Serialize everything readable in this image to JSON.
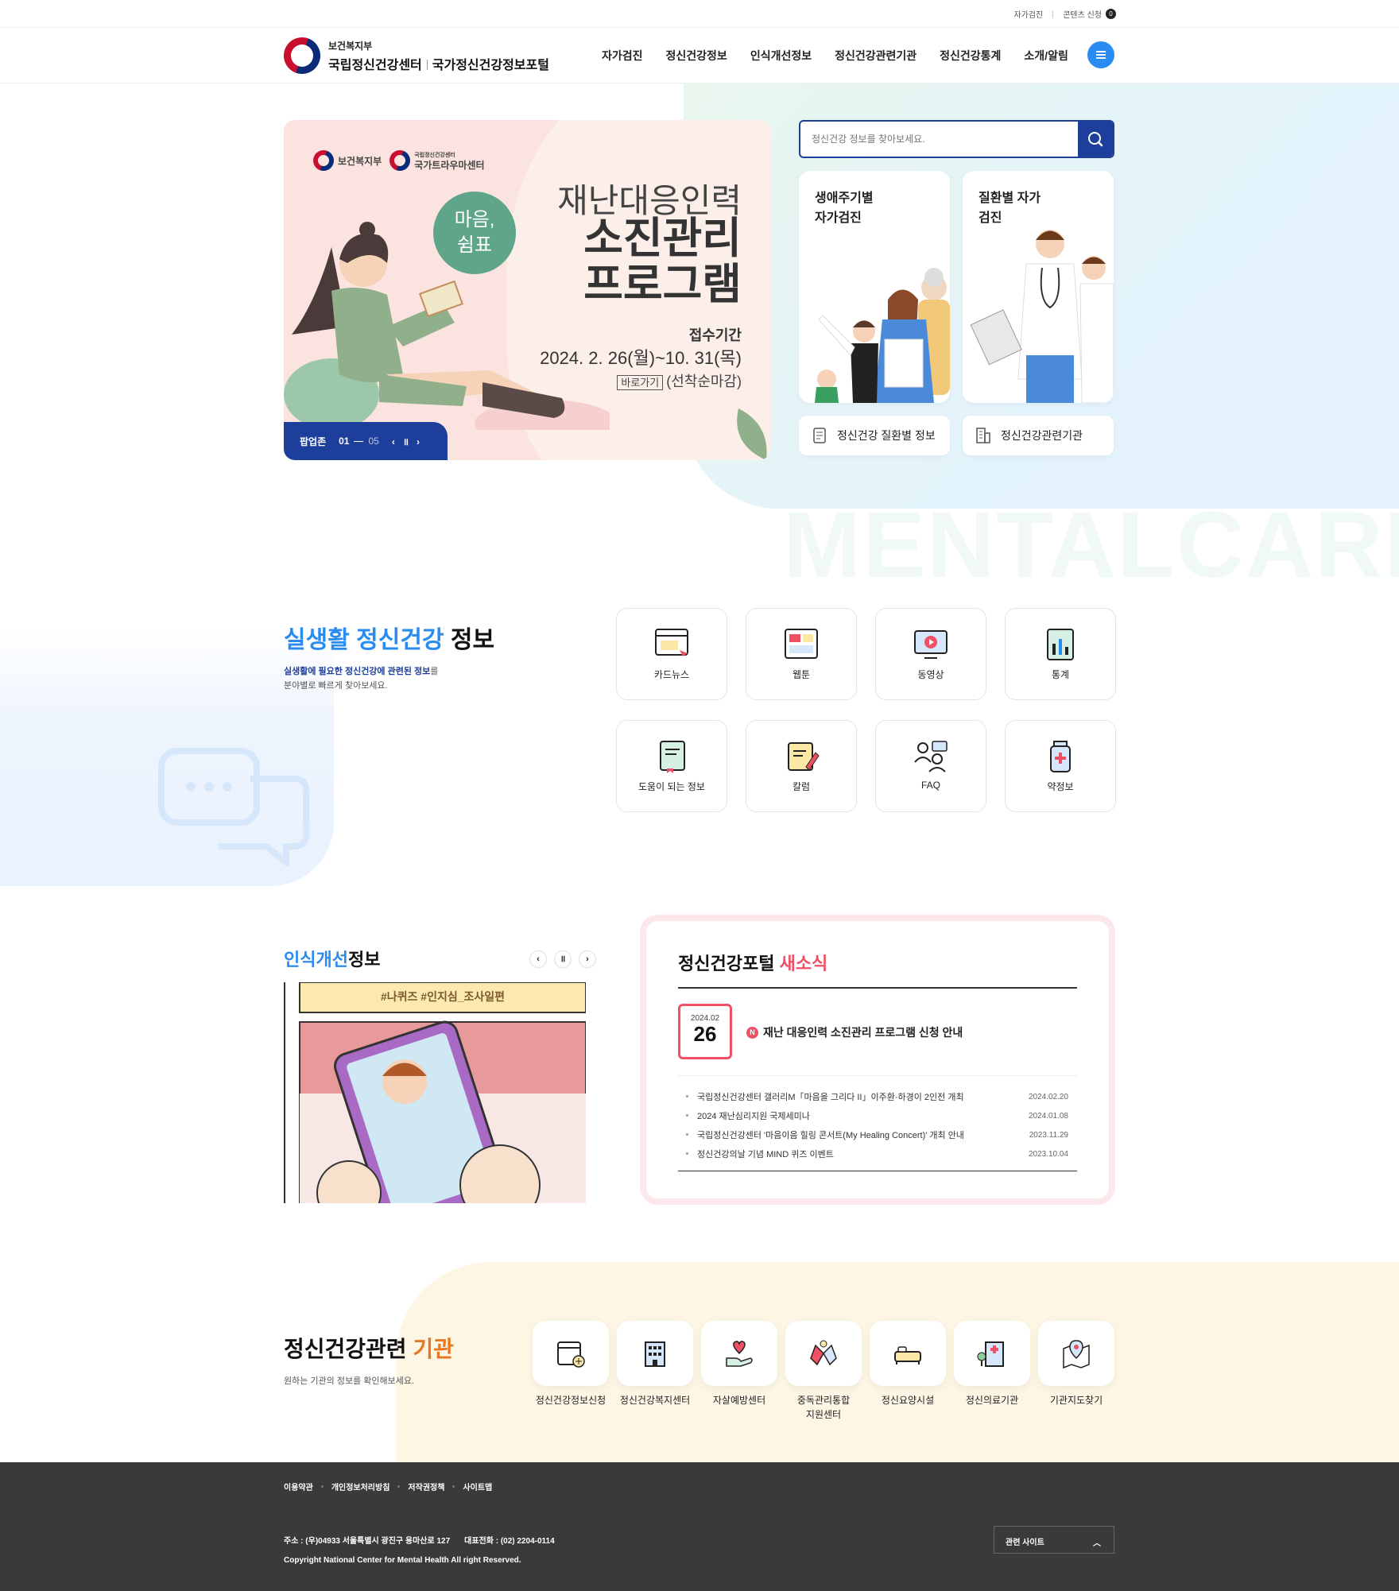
{
  "util": {
    "self_check": "자가검진",
    "content_request": "콘텐츠 신청",
    "content_count": "0"
  },
  "header": {
    "ministry": "보건복지부",
    "center_name": "국립정신건강센터",
    "portal_name": "국가정신건강정보포털",
    "nav": [
      "자가검진",
      "정신건강정보",
      "인식개선정보",
      "정신건강관련기관",
      "정신건강통계",
      "소개/알림"
    ]
  },
  "banner": {
    "logo1": "보건복지부",
    "logo2_small": "국립정신건강센터",
    "logo2": "국가트라우마센터",
    "bubble": "마음,\n쉼표",
    "title_line1": "재난대응인력",
    "title_line2": "소진관리",
    "title_line3": "프로그램",
    "period_label": "접수기간",
    "period": "2024. 2. 26(월)~10. 31(목)",
    "go_label": "바로가기",
    "note": "(선착순마감)",
    "popup_label": "팝업존",
    "current": "01",
    "total": "05"
  },
  "search": {
    "placeholder": "정신건강 정보를 찾아보세요."
  },
  "cards": [
    {
      "title": "생애주기별 자가검진"
    },
    {
      "title": "질환별 자가검진"
    }
  ],
  "quick_links": [
    "정신건강 질환별 정보",
    "정신건강관련기관"
  ],
  "watermark": "MENTALCARE",
  "life": {
    "title_blue": "실생활 정신건강",
    "title_rest": " 정보",
    "desc_bold": "실생활에 필요한 정신건강에 관련된 정보",
    "desc_rest1": "를",
    "desc_line2": "분야별로 빠르게 찾아보세요.",
    "tiles": [
      "카드뉴스",
      "웹툰",
      "동영상",
      "통계",
      "도움이 되는 정보",
      "칼럼",
      "FAQ",
      "약정보"
    ]
  },
  "awareness": {
    "title_blue": "인식개선",
    "title_rest": "정보",
    "comic_caption": "#나퀴즈 #인지심_조사일편"
  },
  "news": {
    "title": "정신건강포털",
    "title_red": "새소식",
    "featured_ym": "2024.02",
    "featured_day": "26",
    "featured_badge": "N",
    "featured_title": "재난 대응인력 소진관리 프로그램 신청 안내",
    "items": [
      {
        "title": "국립정신건강센터 갤러리M「마음을 그리다 II」이주환·하경이 2인전 개최",
        "date": "2024.02.20"
      },
      {
        "title": "2024 재난심리지원 국제세미나",
        "date": "2024.01.08"
      },
      {
        "title": "국립정신건강센터 '마음이음 힐링 콘서트(My Healing Concert)' 개최 안내",
        "date": "2023.11.29"
      },
      {
        "title": "정신건강의날 기념 MIND 퀴즈 이벤트",
        "date": "2023.10.04"
      }
    ]
  },
  "institutions": {
    "title": "정신건강관련",
    "title_orange": "기관",
    "desc": "원하는 기관의 정보를 확인해보세요.",
    "items": [
      "정신건강정보신청",
      "정신건강복지센터",
      "자살예방센터",
      "중독관리통합\n지원센터",
      "정신요양시설",
      "정신의료기관",
      "기관지도찾기"
    ]
  },
  "footer": {
    "links": [
      "이용약관",
      "개인정보처리방침",
      "저작권정책",
      "사이트맵"
    ],
    "address": "주소 : (우)04933 서울특별시 광진구 용마산로 127",
    "phone": "대표전화 : (02) 2204-0114",
    "copyright": "Copyright National Center for Mental Health All right Reserved.",
    "related_sites": "관련 사이트"
  }
}
